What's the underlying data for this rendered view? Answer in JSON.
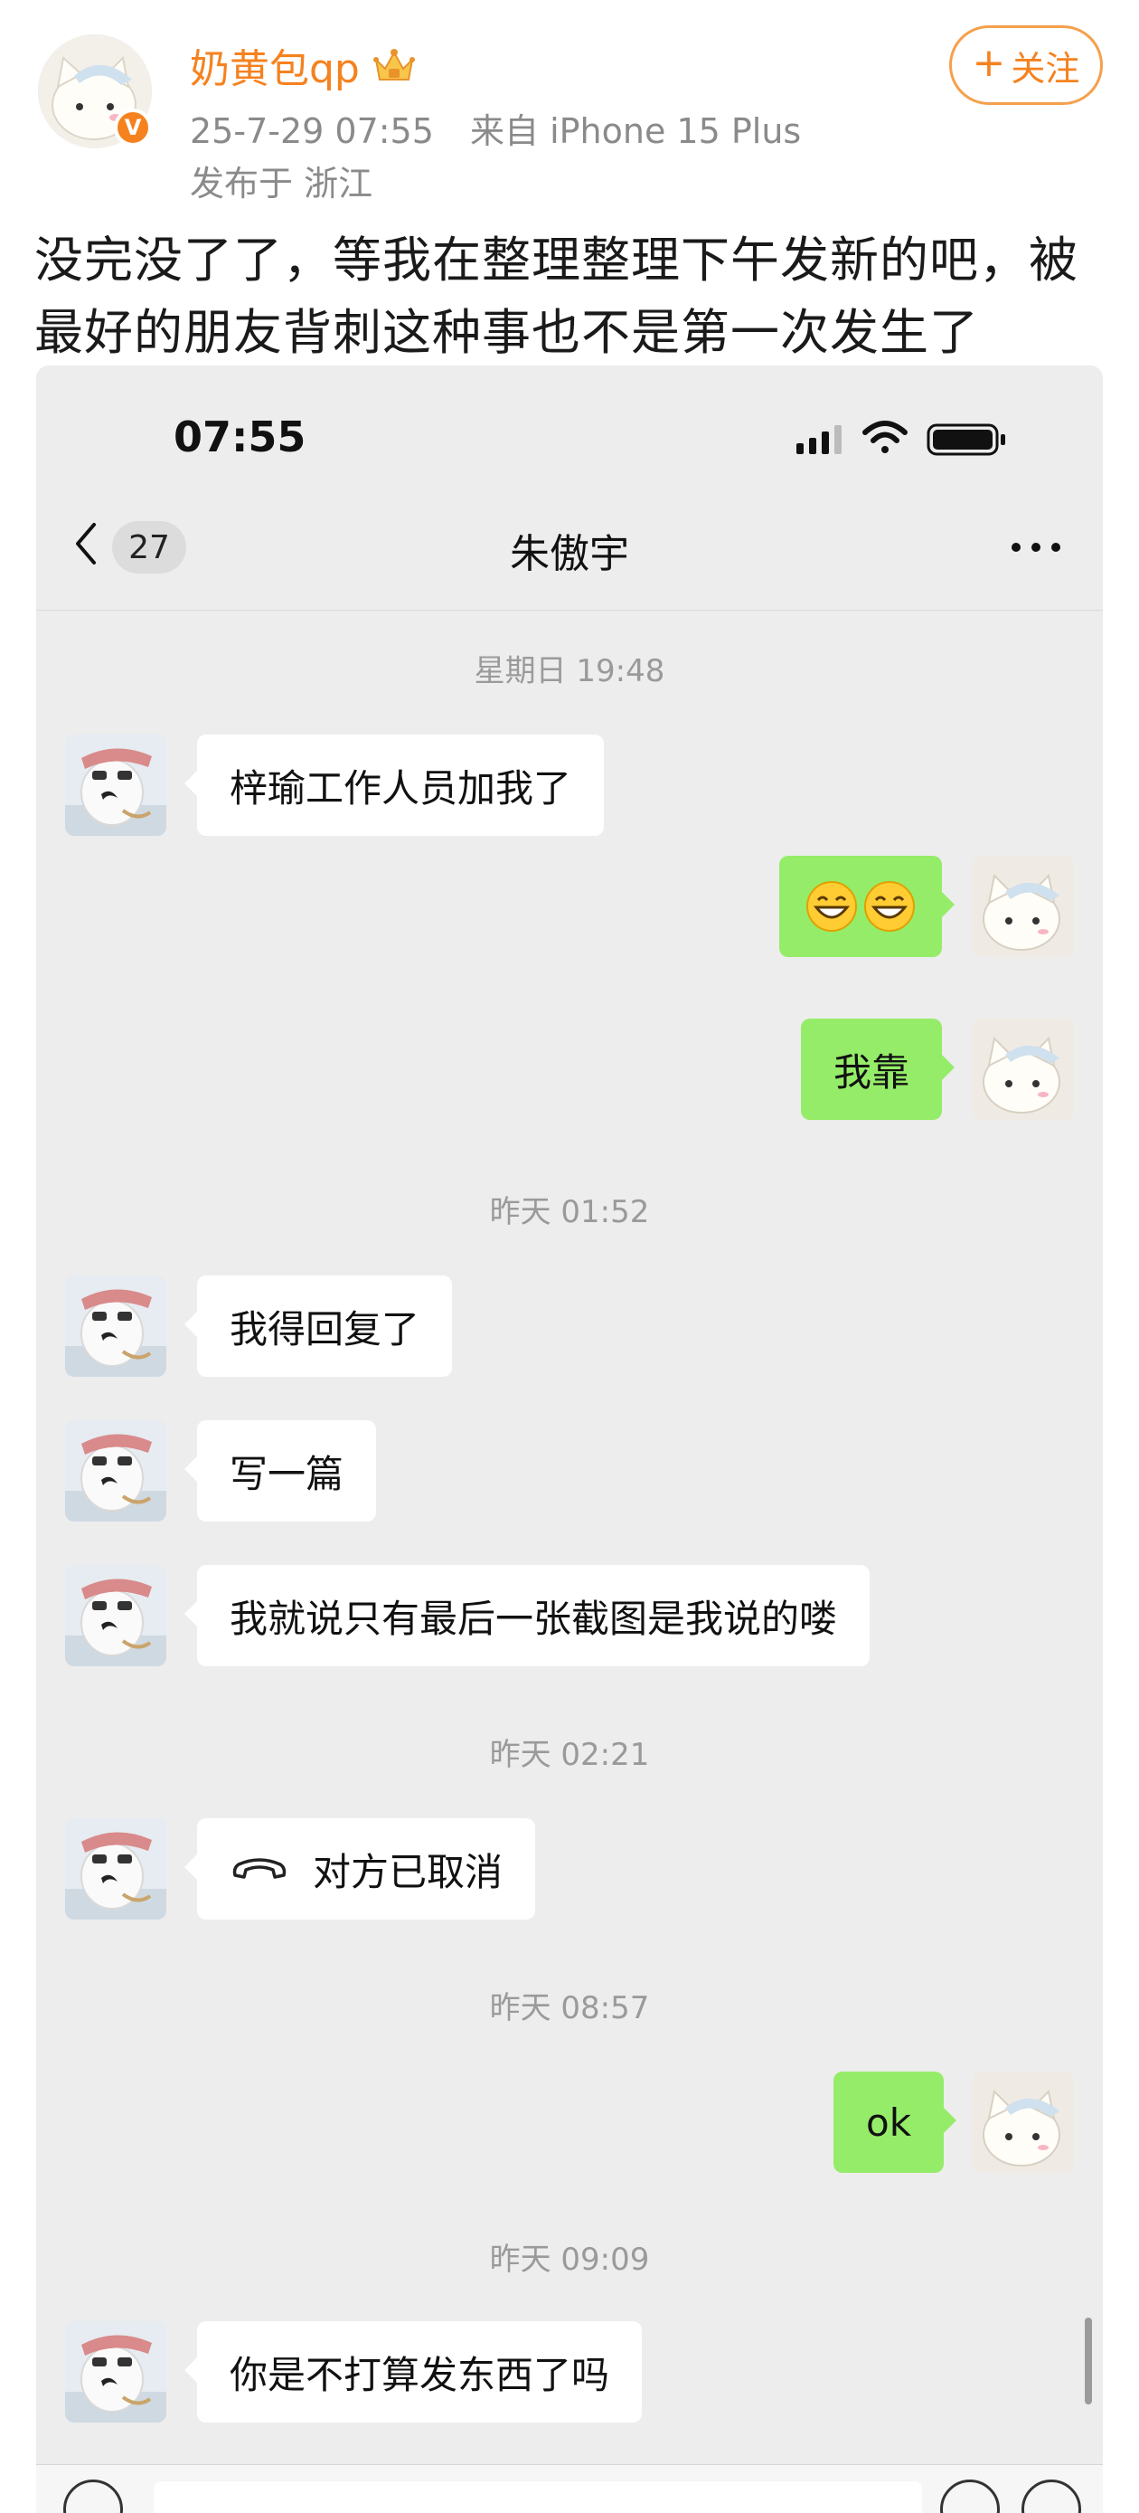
{
  "post": {
    "username": "奶黄包qp",
    "verified_badge": "V",
    "crown_icon": "crown-icon",
    "date": "25-7-29 07:55",
    "source": "来自 iPhone 15 Plus",
    "location": "发布于 浙江",
    "follow_plus": "+",
    "follow_label": "关注",
    "text": "没完没了了，等我在整理整理下午发新的吧，被最好的朋友背刺这种事也不是第一次发生了",
    "colors": {
      "accent": "#f5821f",
      "meta": "#8a8a8a"
    }
  },
  "chat": {
    "status_time": "07:55",
    "unread_count": "27",
    "contact_name": "朱傲宇",
    "colors": {
      "bubble_self": "#95ec69",
      "bubble_other": "#ffffff",
      "background": "#ededed"
    },
    "timestamps": [
      "星期日 19:48",
      "昨天 01:52",
      "昨天 02:21",
      "昨天 08:57",
      "昨天 09:09"
    ],
    "messages": [
      {
        "from": "friend",
        "text": "梓瑜工作人员加我了"
      },
      {
        "from": "me",
        "emoji": [
          "grinning-face-emoji",
          "grinning-face-emoji"
        ]
      },
      {
        "from": "me",
        "text": "我靠"
      },
      {
        "from": "friend",
        "text": "我得回复了"
      },
      {
        "from": "friend",
        "text": "写一篇"
      },
      {
        "from": "friend",
        "text": "我就说只有最后一张截图是我说的喽"
      },
      {
        "from": "friend",
        "icon": "phone-hangup-icon",
        "text": "对方已取消"
      },
      {
        "from": "me",
        "text": "ok"
      },
      {
        "from": "friend",
        "text": "你是不打算发东西了吗"
      }
    ]
  }
}
